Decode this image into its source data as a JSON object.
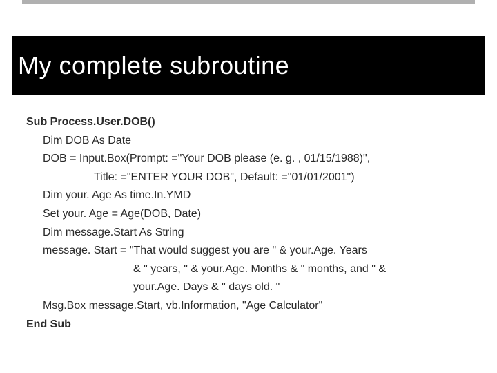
{
  "title": "My complete subroutine",
  "code": {
    "l1": "Sub Process.User.DOB()",
    "l2": "Dim DOB As Date",
    "l3": "DOB = Input.Box(Prompt: =\"Your DOB please (e. g. , 01/15/1988)\",",
    "l3b": "Title: =\"ENTER YOUR DOB\", Default: =\"01/01/2001\")",
    "l4": "Dim your. Age As time.In.YMD",
    "l5": "Set your. Age = Age(DOB, Date)",
    "l6": "Dim message.Start As String",
    "l7": "message. Start = \"That would suggest you are \" & your.Age. Years",
    "l7b": "& \" years, \" & your.Age. Months & \" months, and \" &",
    "l7c": "your.Age. Days & \" days old. \"",
    "l8": "Msg.Box message.Start, vb.Information, \"Age Calculator\"",
    "l9": "End Sub"
  }
}
